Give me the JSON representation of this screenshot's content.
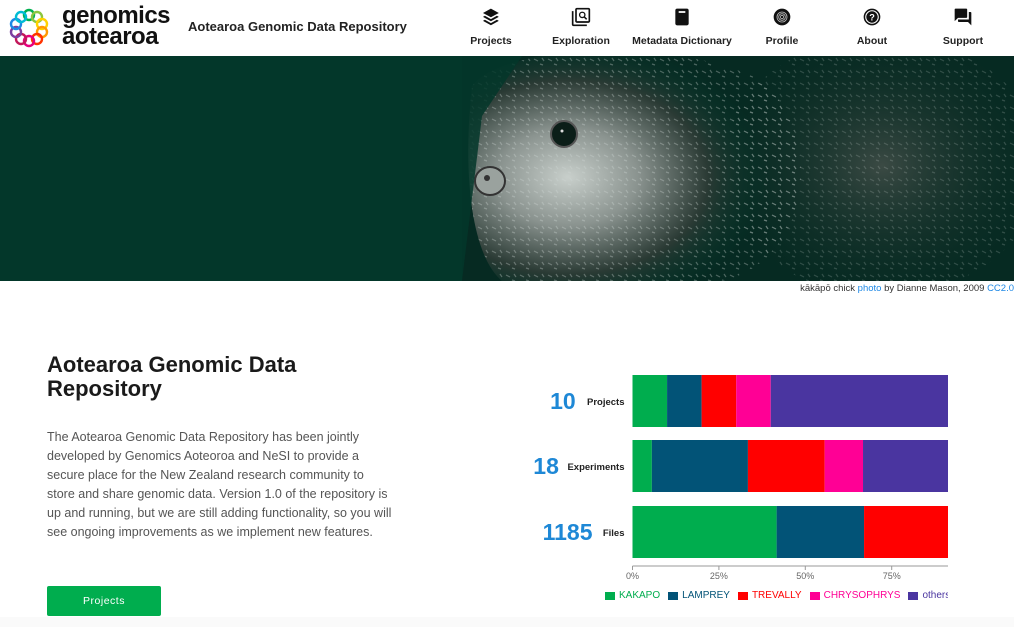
{
  "header": {
    "logo_text_line1": "genomics",
    "logo_text_line2": "aotearoa",
    "site_title": "Aotearoa Genomic Data Repository",
    "nav": [
      {
        "label": "Projects",
        "icon": "layers-icon"
      },
      {
        "label": "Exploration",
        "icon": "image-search-icon"
      },
      {
        "label": "Metadata Dictionary",
        "icon": "book-icon"
      },
      {
        "label": "Profile",
        "icon": "fingerprint-icon"
      },
      {
        "label": "About",
        "icon": "help-circle-icon"
      },
      {
        "label": "Support",
        "icon": "forum-icon"
      }
    ]
  },
  "hero": {
    "caption_prefix": "kākāpō chick ",
    "caption_link": "photo",
    "caption_middle": " by Dianne Mason, 2009 ",
    "caption_license": "CC2.0"
  },
  "intro": {
    "title": "Aotearoa Genomic Data Repository",
    "body": "The Aotearoa Genomic Data Repository has been jointly developed by Genomics Aoteoroa and NeSI to provide a secure place for the New Zealand research community to store and share genomic data. Version 1.0 of the repository is up and running, but we are still adding functionality, so you will see ongoing improvements as we implement new features.",
    "button_label": "Projects"
  },
  "chart_data": {
    "type": "bar",
    "orientation": "horizontal",
    "stacked": "percent",
    "categories": [
      "Projects",
      "Experiments",
      "Files"
    ],
    "totals": [
      10,
      18,
      1185
    ],
    "series": [
      {
        "name": "KAKAPO",
        "color": "#00ad4e",
        "values": [
          10,
          5.6,
          41.7
        ]
      },
      {
        "name": "LAMPREY",
        "color": "#025377",
        "values": [
          10,
          27.8,
          25.3
        ]
      },
      {
        "name": "TREVALLY",
        "color": "#ff0000",
        "values": [
          10,
          22.2,
          33.0
        ]
      },
      {
        "name": "CHRYSOPHRYS",
        "color": "#ff0095",
        "values": [
          10,
          11.1,
          0
        ]
      },
      {
        "name": "others",
        "color": "#4a35a0",
        "values": [
          60,
          33.3,
          0
        ]
      }
    ],
    "x_ticks": [
      "0%",
      "25%",
      "50%",
      "75%"
    ],
    "xlim": [
      0,
      100
    ],
    "legend_position": "bottom"
  }
}
